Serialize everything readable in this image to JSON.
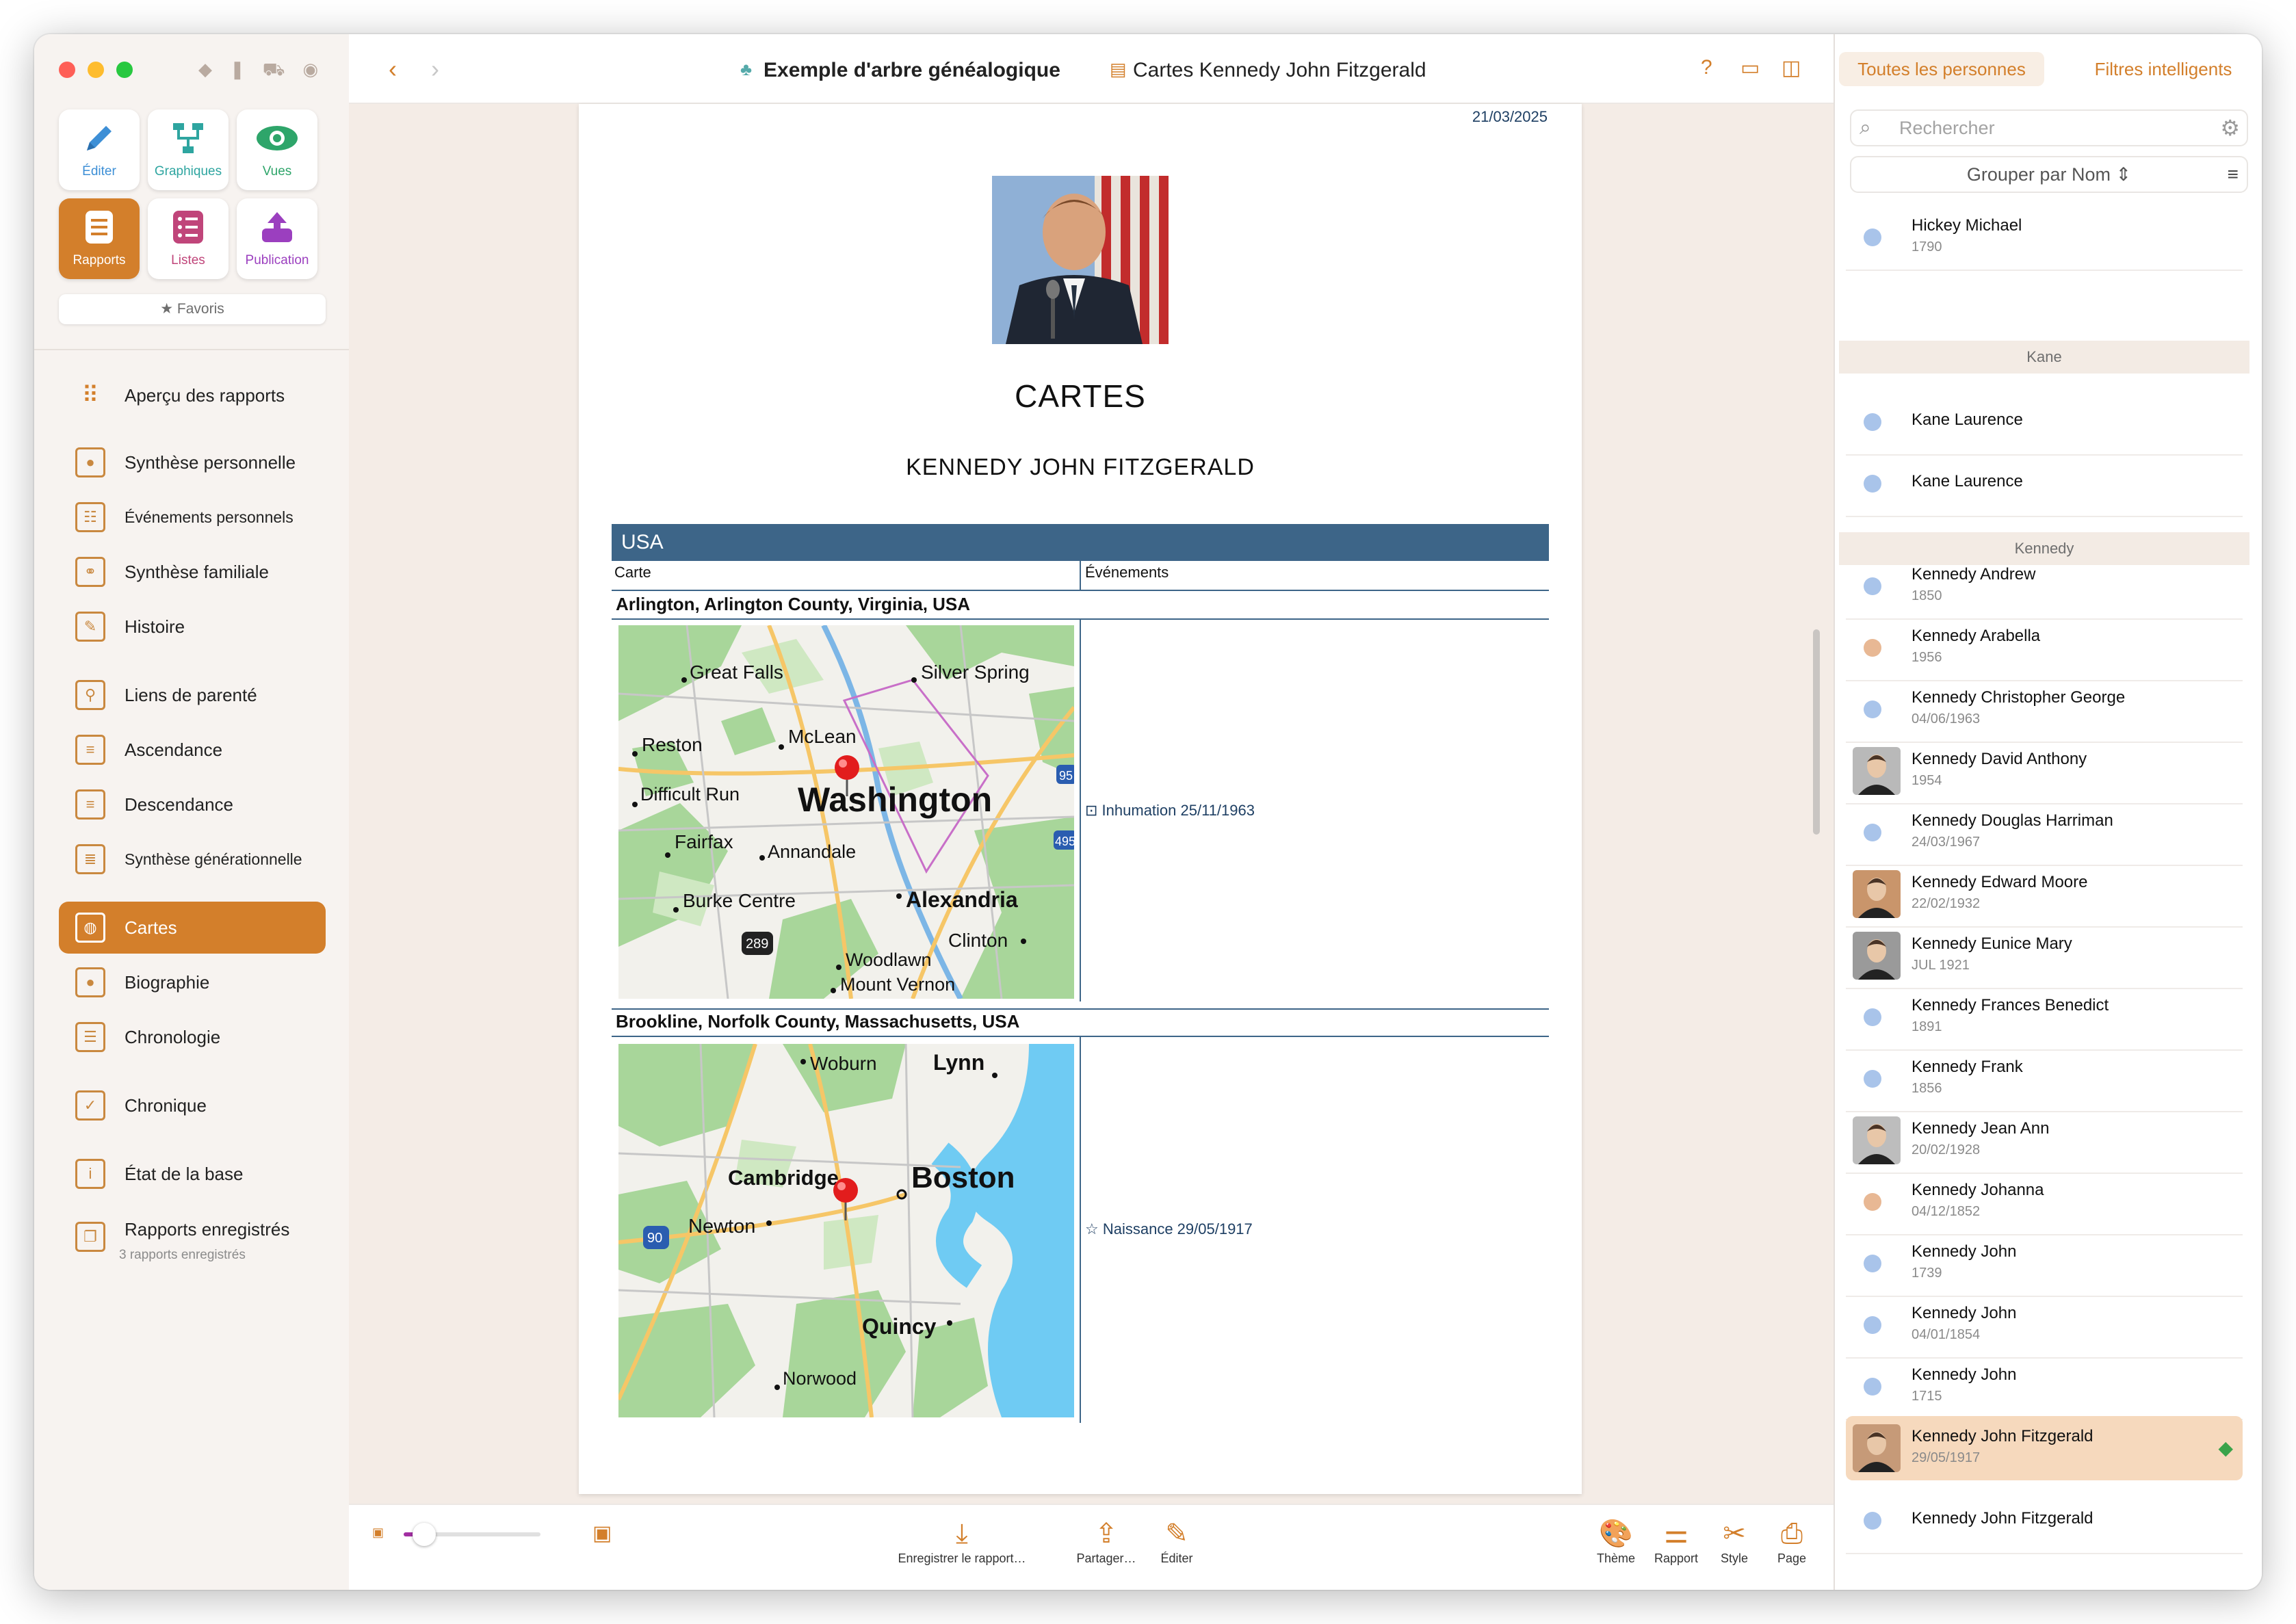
{
  "app": {
    "sidebar_tiles": [
      {
        "label": "Éditer",
        "icon": "pencil-icon",
        "color": "#3d8fd6"
      },
      {
        "label": "Graphiques",
        "icon": "tree-chart-icon",
        "color": "#2ea5a0"
      },
      {
        "label": "Vues",
        "icon": "eye-icon",
        "color": "#2ea56a"
      },
      {
        "label": "Rapports",
        "icon": "report-icon",
        "color": "#ffffff"
      },
      {
        "label": "Listes",
        "icon": "list-icon",
        "color": "#c0457a"
      },
      {
        "label": "Publication",
        "icon": "upload-icon",
        "color": "#9b3fbf"
      }
    ],
    "favoris": "★ Favoris",
    "nav": [
      {
        "label": "Aperçu des rapports",
        "icon": "grid-icon"
      },
      {
        "label": "Synthèse personnelle",
        "icon": "person-report-icon"
      },
      {
        "label": "Événements personnels",
        "icon": "event-report-icon"
      },
      {
        "label": "Synthèse familiale",
        "icon": "family-report-icon"
      },
      {
        "label": "Histoire",
        "icon": "pen-report-icon"
      },
      {
        "label": "Liens de parenté",
        "icon": "relationship-icon"
      },
      {
        "label": "Ascendance",
        "icon": "ancestors-icon"
      },
      {
        "label": "Descendance",
        "icon": "descendants-icon"
      },
      {
        "label": "Synthèse générationnelle",
        "icon": "generations-icon"
      },
      {
        "label": "Cartes",
        "icon": "map-report-icon"
      },
      {
        "label": "Biographie",
        "icon": "biography-icon"
      },
      {
        "label": "Chronologie",
        "icon": "timeline-icon"
      },
      {
        "label": "Chronique",
        "icon": "chronicle-icon"
      },
      {
        "label": "État de la base",
        "icon": "info-icon"
      },
      {
        "label": "Rapports enregistrés",
        "icon": "saved-reports-icon"
      }
    ],
    "saved_reports_sub": "3 rapports enregistrés",
    "accent": "#d37f2b"
  },
  "toolbar": {
    "tree_title": "Exemple d'arbre généalogique",
    "report_title": "Cartes Kennedy John Fitzgerald"
  },
  "report": {
    "date": "21/03/2025",
    "title": "CARTES",
    "subtitle": "KENNEDY JOHN FITZGERALD",
    "country": "USA",
    "col_map": "Carte",
    "col_events": "Événements",
    "places": [
      {
        "name": "Arlington, Arlington County, Virginia, USA",
        "event": "Inhumation 25/11/1963",
        "map_labels": [
          "Great Falls",
          "Silver Spring",
          "Reston",
          "McLean",
          "Difficult Run",
          "Washington",
          "Fairfax",
          "Annandale",
          "Burke Centre",
          "Alexandria",
          "Clinton",
          "Woodlawn",
          "Mount Vernon",
          "95",
          "495",
          "289"
        ]
      },
      {
        "name": "Brookline, Norfolk County, Massachusetts, USA",
        "event": "Naissance 29/05/1917",
        "map_labels": [
          "Woburn",
          "Lynn",
          "Cambridge",
          "Boston",
          "Newton",
          "Quincy",
          "Norwood",
          "90"
        ]
      }
    ]
  },
  "bottom": {
    "zoom_level": 0.15,
    "buttons": [
      {
        "label": "Enregistrer le rapport…",
        "icon": "download-icon"
      },
      {
        "label": "Partager…",
        "icon": "share-icon"
      },
      {
        "label": "Éditer",
        "icon": "edit-icon"
      },
      {
        "label": "Thème",
        "icon": "palette-icon"
      },
      {
        "label": "Rapport",
        "icon": "toggles-icon"
      },
      {
        "label": "Style",
        "icon": "style-icon"
      },
      {
        "label": "Page",
        "icon": "page-icon"
      }
    ]
  },
  "people": {
    "tab_all": "Toutes les personnes",
    "tab_smart": "Filtres intelligents",
    "search_placeholder": "Rechercher",
    "group_by": "Grouper par Nom",
    "sections": [
      "Kane",
      "Kennedy"
    ],
    "rows": [
      {
        "name": "Hickey Michael",
        "date": "1790",
        "dot": "#a9c4ea"
      },
      {
        "name": "Kane Laurence",
        "date": "",
        "dot": "#a9c4ea"
      },
      {
        "name": "Kane Laurence",
        "date": "",
        "dot": "#a9c4ea"
      },
      {
        "name": "Kennedy Andrew",
        "date": "1850",
        "dot": "#a9c4ea"
      },
      {
        "name": "Kennedy Arabella",
        "date": "1956",
        "dot": "#e8b894"
      },
      {
        "name": "Kennedy Christopher George",
        "date": "04/06/1963",
        "dot": "#a9c4ea"
      },
      {
        "name": "Kennedy David Anthony",
        "date": "1954",
        "dot": "photo"
      },
      {
        "name": "Kennedy Douglas Harriman",
        "date": "24/03/1967",
        "dot": "#a9c4ea"
      },
      {
        "name": "Kennedy Edward Moore",
        "date": "22/02/1932",
        "dot": "photo"
      },
      {
        "name": "Kennedy Eunice Mary",
        "date": "JUL 1921",
        "dot": "photo"
      },
      {
        "name": "Kennedy Frances Benedict",
        "date": "1891",
        "dot": "#a9c4ea"
      },
      {
        "name": "Kennedy Frank",
        "date": "1856",
        "dot": "#a9c4ea"
      },
      {
        "name": "Kennedy Jean Ann",
        "date": "20/02/1928",
        "dot": "photo"
      },
      {
        "name": "Kennedy Johanna",
        "date": "04/12/1852",
        "dot": "#e8b894"
      },
      {
        "name": "Kennedy John",
        "date": "1739",
        "dot": "#a9c4ea"
      },
      {
        "name": "Kennedy John",
        "date": "04/01/1854",
        "dot": "#a9c4ea"
      },
      {
        "name": "Kennedy John",
        "date": "1715",
        "dot": "#a9c4ea"
      },
      {
        "name": "Kennedy John Fitzgerald",
        "date": "29/05/1917",
        "dot": "photo"
      },
      {
        "name": "Kennedy John Fitzgerald",
        "date": "",
        "dot": "#a9c4ea"
      }
    ]
  }
}
